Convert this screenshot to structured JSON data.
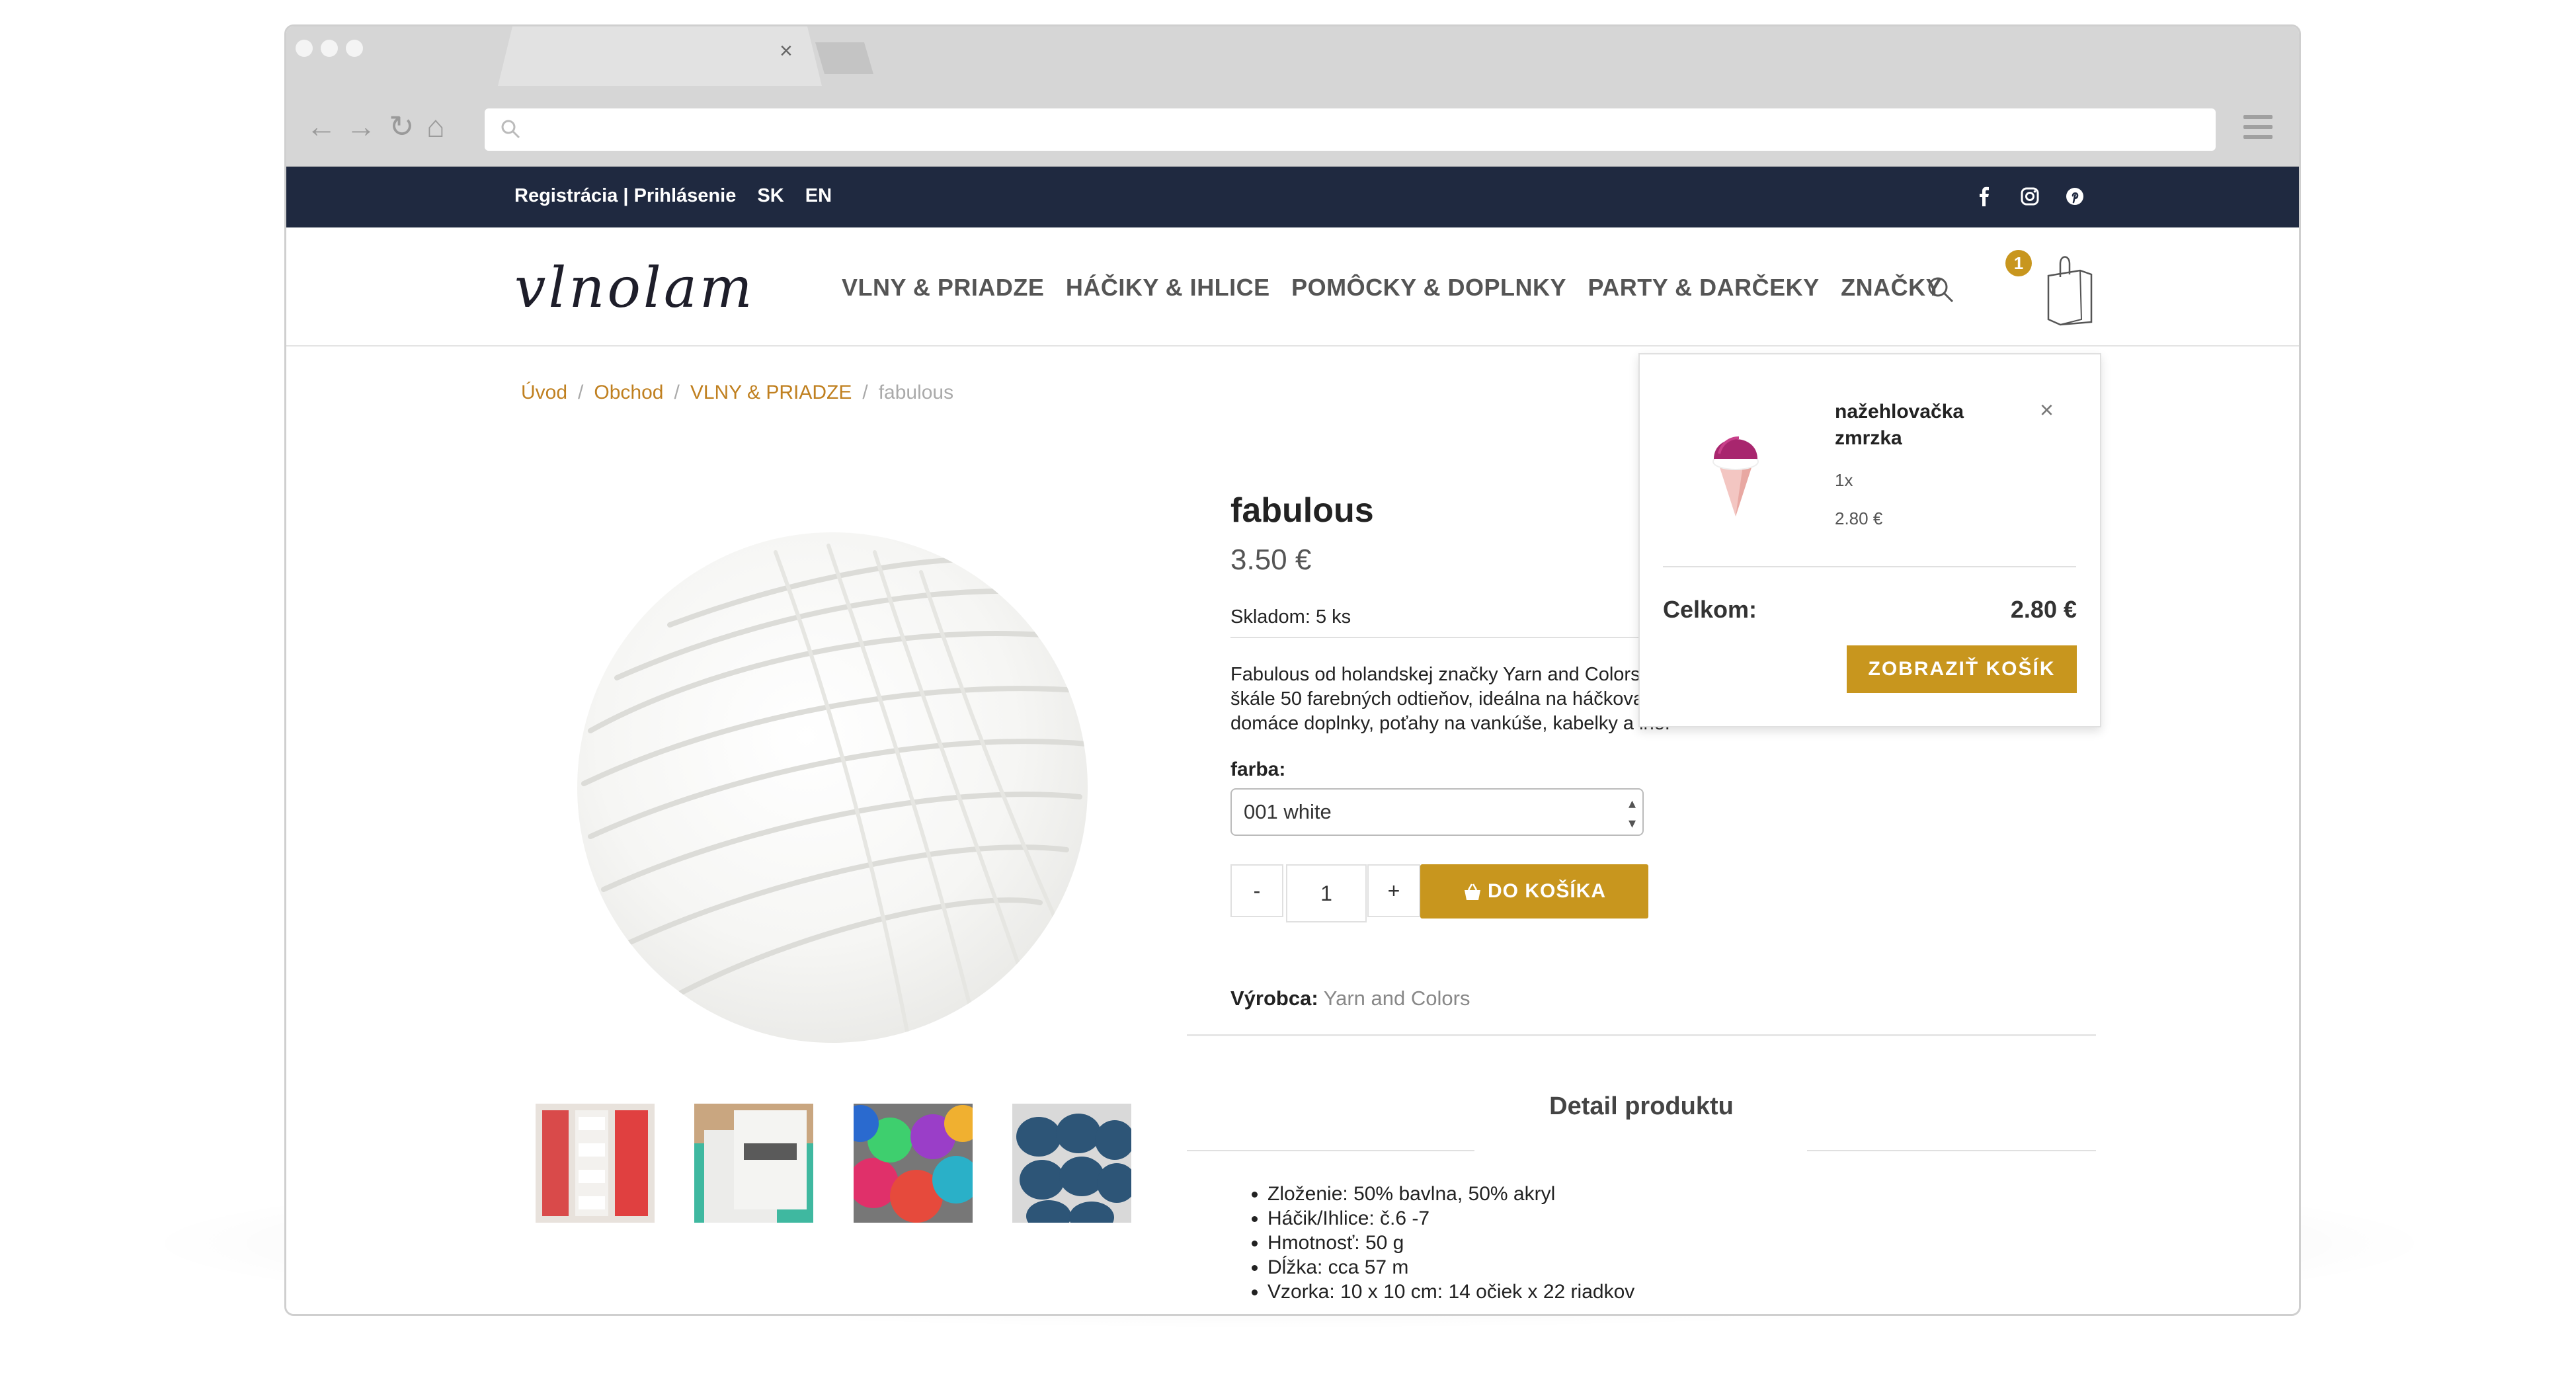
{
  "browser": {
    "tab_close_glyph": "×",
    "url": ""
  },
  "topbar": {
    "account_link": "Registrácia | Prihlásenie",
    "lang_sk": "SK",
    "lang_en": "EN",
    "social_icons": [
      "facebook-icon",
      "instagram-icon",
      "pinterest-icon"
    ]
  },
  "header": {
    "logo": "vlnolam",
    "nav": [
      "VLNY & PRIADZE",
      "HÁČIKY & IHLICE",
      "POMÔCKY & DOPLNKY",
      "PARTY & DARČEKY",
      "ZNAČKY"
    ],
    "cart_count": "1"
  },
  "breadcrumb": {
    "home": "Úvod",
    "shop": "Obchod",
    "category": "VLNY & PRIADZE",
    "current": "fabulous",
    "sep": "/"
  },
  "product": {
    "title": "fabulous",
    "price": "3.50 €",
    "stock": "Skladom: 5 ks",
    "description": "Fabulous od holandskej značky Yarn and Colors je zmes bavlny a akrylu v širokej škále 50 farebných odtieňov, ideálna na háčkovanie väčších projektov, ako sú domáce doplnky, poťahy na vankúše, kabelky a iné.",
    "color_label": "farba:",
    "color_selected": "001 white",
    "qty_minus": "-",
    "qty_value": "1",
    "qty_plus": "+",
    "add_to_cart": "DO KOŠÍKA",
    "maker_label": "Výrobca:",
    "maker_value": "Yarn and Colors",
    "detail_title": "Detail produktu",
    "specs": [
      "Zloženie: 50% bavlna, 50% akryl",
      "Háčik/Ihlice: č.6 -7",
      "Hmotnosť: 50 g",
      "Dĺžka: cca 57 m",
      "Vzorka: 10 x 10 cm: 14 očiek x 22 riadkov"
    ]
  },
  "minicart": {
    "item_name": "nažehlovačka zmrzka",
    "item_qty": "1x",
    "item_price": "2.80 €",
    "close_glyph": "×",
    "total_label": "Celkom:",
    "total_value": "2.80 €",
    "view_cart": "ZOBRAZIŤ KOŠÍK"
  },
  "colors": {
    "accent": "#c8961e",
    "topbar": "#1f2940",
    "link": "#c08020"
  }
}
